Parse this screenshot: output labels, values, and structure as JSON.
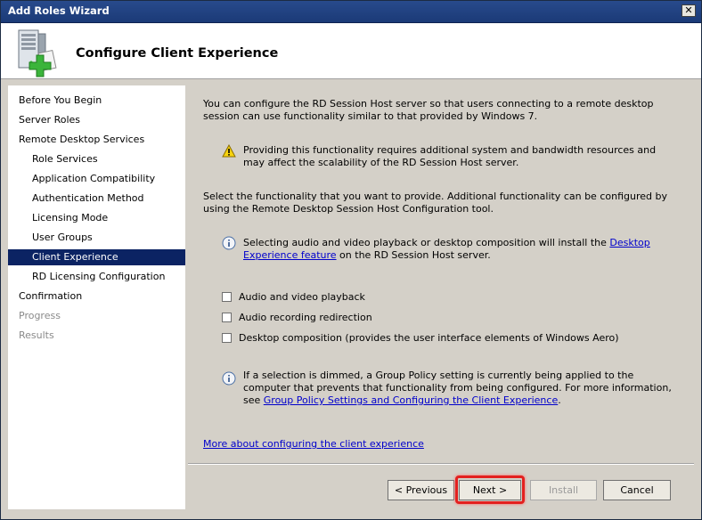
{
  "window": {
    "title": "Add Roles Wizard",
    "close_glyph": "✕",
    "heading": "Configure Client Experience",
    "header_icon": "server-with-green-plus-icon"
  },
  "nav": {
    "items": [
      {
        "label": "Before You Begin",
        "level": 0,
        "state": "normal"
      },
      {
        "label": "Server Roles",
        "level": 0,
        "state": "normal"
      },
      {
        "label": "Remote Desktop Services",
        "level": 0,
        "state": "normal"
      },
      {
        "label": "Role Services",
        "level": 1,
        "state": "normal"
      },
      {
        "label": "Application Compatibility",
        "level": 1,
        "state": "normal"
      },
      {
        "label": "Authentication Method",
        "level": 1,
        "state": "normal"
      },
      {
        "label": "Licensing Mode",
        "level": 1,
        "state": "normal"
      },
      {
        "label": "User Groups",
        "level": 1,
        "state": "normal"
      },
      {
        "label": "Client Experience",
        "level": 1,
        "state": "selected"
      },
      {
        "label": "RD Licensing Configuration",
        "level": 1,
        "state": "normal"
      },
      {
        "label": "Confirmation",
        "level": 0,
        "state": "normal"
      },
      {
        "label": "Progress",
        "level": 0,
        "state": "disabled"
      },
      {
        "label": "Results",
        "level": 0,
        "state": "disabled"
      }
    ]
  },
  "content": {
    "intro": "You can configure the RD Session Host server so that users connecting to a remote desktop session can use functionality similar to that provided by Windows 7.",
    "warning": "Providing this functionality requires additional system and bandwidth resources and may affect the scalability of the RD Session Host server.",
    "select_text": "Select the functionality that you want to provide. Additional functionality can be configured by using the Remote Desktop Session Host Configuration tool.",
    "info1": {
      "before": "Selecting audio and video playback or desktop composition will install the ",
      "link": "Desktop Experience feature",
      "after": " on the RD Session Host server."
    },
    "checkboxes": [
      {
        "label": "Audio and video playback",
        "checked": false
      },
      {
        "label": "Audio recording redirection",
        "checked": false
      },
      {
        "label": "Desktop composition (provides the user interface elements of Windows Aero)",
        "checked": false
      }
    ],
    "info2": {
      "before": "If a selection is dimmed, a Group Policy setting is currently being applied to the computer that prevents that functionality from being configured. For more information, see ",
      "link": "Group Policy Settings and Configuring the Client Experience",
      "after": "."
    },
    "more_link": "More about configuring the client experience"
  },
  "buttons": {
    "previous": "< Previous",
    "next": "Next >",
    "install": "Install",
    "cancel": "Cancel"
  },
  "colors": {
    "selected_nav_bg": "#0b2363",
    "link": "#0000cc",
    "highlight": "#e3201f"
  }
}
